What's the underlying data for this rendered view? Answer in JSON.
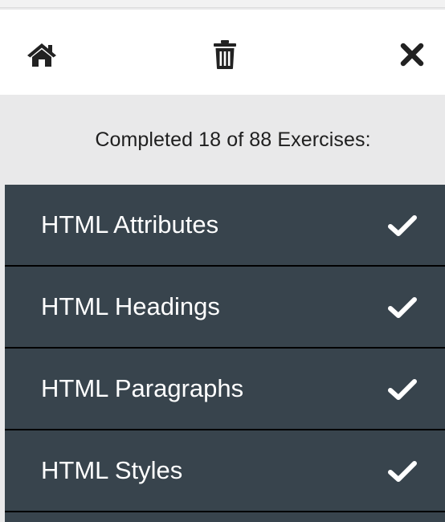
{
  "toolbar": {
    "home_icon": "home-icon",
    "trash_icon": "trash-icon",
    "close_icon": "close-icon"
  },
  "progress": {
    "text": "Completed 18 of 88 Exercises:",
    "completed": 18,
    "total": 88
  },
  "exercises": [
    {
      "label": "HTML Attributes",
      "status_icon": "checkmark-icon"
    },
    {
      "label": "HTML Headings",
      "status_icon": "checkmark-icon"
    },
    {
      "label": "HTML Paragraphs",
      "status_icon": "checkmark-icon"
    },
    {
      "label": "HTML Styles",
      "status_icon": "checkmark-icon"
    }
  ],
  "colors": {
    "list_background": "#38444d",
    "toolbar_background": "#ffffff",
    "progress_background": "#e9e9ea",
    "icon_color": "#222222",
    "text_on_dark": "#ffffff"
  }
}
